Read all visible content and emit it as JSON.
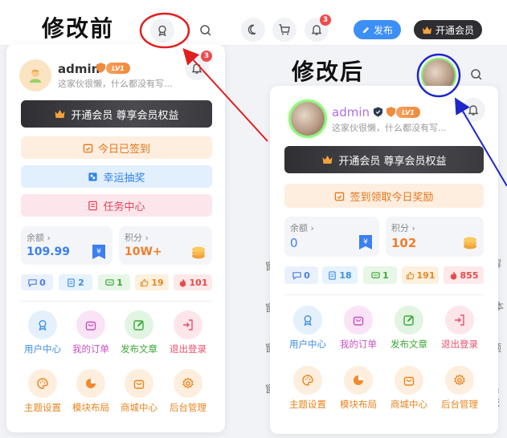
{
  "captions": {
    "before": "修改前",
    "after": "修改后"
  },
  "topbar": {
    "notif_count": "3",
    "publish_label": "发布",
    "vip_label": "开通会员"
  },
  "before": {
    "user": {
      "name": "admin",
      "level": "LV1",
      "bio": "这家伙很懒，什么都没有写...",
      "notif_count": "3"
    },
    "vip_banner": "开通会员 尊享会员权益",
    "checkin": "今日已签到",
    "lottery": "幸运抽奖",
    "tasks": "任务中心",
    "balance": {
      "label": "余额",
      "value": "109.99"
    },
    "points": {
      "label": "积分",
      "value": "10W+"
    },
    "counters": [
      "0",
      "2",
      "1",
      "19",
      "101"
    ],
    "menu": [
      "用户中心",
      "我的订单",
      "发布文章",
      "退出登录",
      "主题设置",
      "模块布局",
      "商城中心",
      "后台管理"
    ]
  },
  "after": {
    "user": {
      "name": "admin",
      "level": "LV1",
      "bio": "这家伙很懒，什么都没有写..."
    },
    "vip_banner": "开通会员 尊享会员权益",
    "checkin": "签到领取今日奖励",
    "balance": {
      "label": "余额",
      "value": "0"
    },
    "points": {
      "label": "积分",
      "value": "102"
    },
    "counters": [
      "0",
      "18",
      "1",
      "191",
      "855"
    ],
    "menu": [
      "用户中心",
      "我的订单",
      "发布文章",
      "退出登录",
      "主题设置",
      "模块布局",
      "商城中心",
      "后台管理"
    ]
  },
  "background_fragments": [
    "解",
    "本",
    "题",
    "系统"
  ],
  "colors": {
    "accent_blue": "#3c8ff5",
    "vip_orange": "#f07e2c",
    "annotation_red": "#e02020",
    "annotation_blue": "#1f27c9",
    "avatar_ring": "#7df46a"
  }
}
